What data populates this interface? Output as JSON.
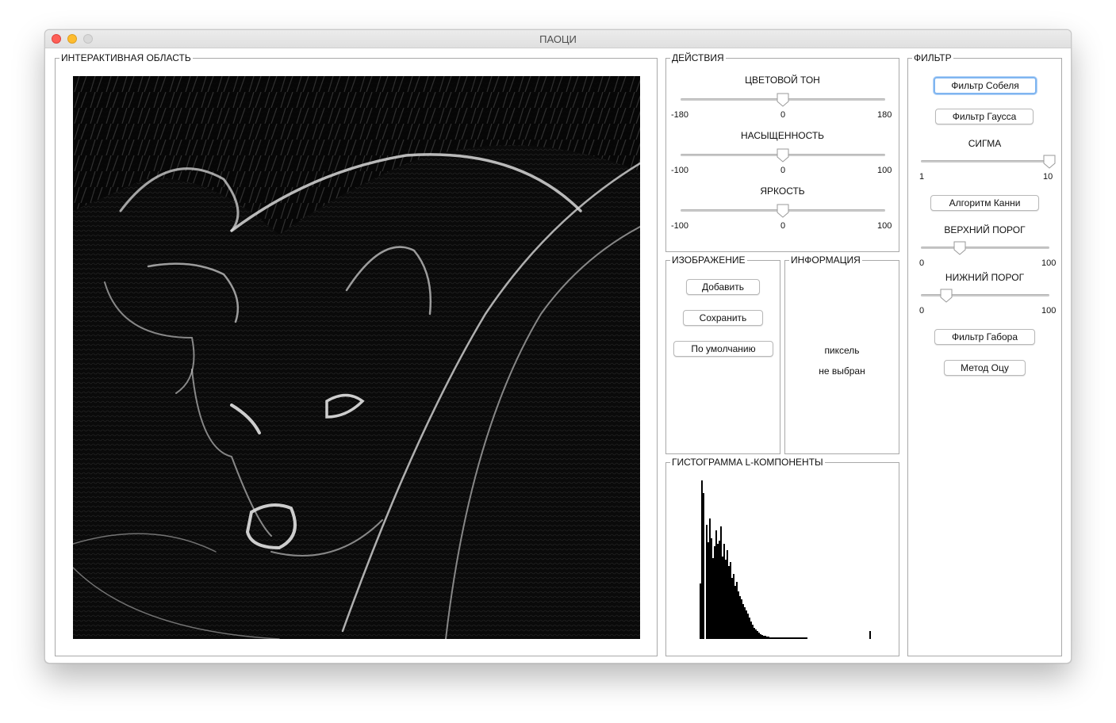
{
  "window": {
    "title": "ПАОЦИ"
  },
  "interactive": {
    "legend": "ИНТЕРАКТИВНАЯ ОБЛАСТЬ"
  },
  "actions": {
    "legend": "ДЕЙСТВИЯ",
    "hue": {
      "label": "ЦВЕТОВОЙ ТОН",
      "min": "-180",
      "mid": "0",
      "max": "180",
      "value": 0.5
    },
    "saturation": {
      "label": "НАСЫЩЕННОСТЬ",
      "min": "-100",
      "mid": "0",
      "max": "100",
      "value": 0.5
    },
    "brightness": {
      "label": "ЯРКОСТЬ",
      "min": "-100",
      "mid": "0",
      "max": "100",
      "value": 0.5
    }
  },
  "image": {
    "legend": "ИЗОБРАЖЕНИЕ",
    "add": "Добавить",
    "save": "Сохранить",
    "default": "По умолчанию"
  },
  "info": {
    "legend": "ИНФОРМАЦИЯ",
    "line1": "пиксель",
    "line2": "не выбран"
  },
  "histogram": {
    "legend": "ГИСТОГРАММА L-КОМПОНЕНТЫ"
  },
  "filter": {
    "legend": "ФИЛЬТР",
    "sobel": "Фильтр Собеля",
    "gauss": "Фильтр Гаусса",
    "sigma": {
      "label": "СИГМА",
      "min": "1",
      "max": "10",
      "value": 1.0
    },
    "canny": "Алгоритм Канни",
    "upper": {
      "label": "ВЕРХНИЙ ПОРОГ",
      "min": "0",
      "max": "100",
      "value": 0.3
    },
    "lower": {
      "label": "НИЖНИЙ ПОРОГ",
      "min": "0",
      "max": "100",
      "value": 0.2
    },
    "gabor": "Фильтр Габора",
    "otsu": "Метод Оцу"
  },
  "colors": {
    "focus": "#7fb5f0",
    "close": "#fe5f57",
    "minimize": "#febc2e"
  }
}
